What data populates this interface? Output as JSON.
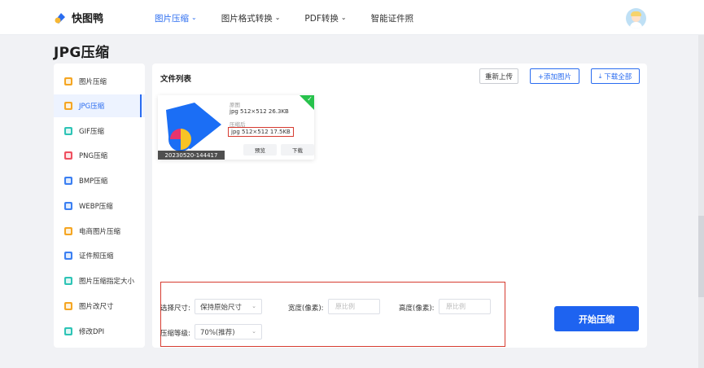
{
  "header": {
    "logo_text": "快图鸭",
    "nav": [
      {
        "label": "图片压缩",
        "chevron": true,
        "active": true
      },
      {
        "label": "图片格式转换",
        "chevron": true
      },
      {
        "label": "PDF转换",
        "chevron": true
      },
      {
        "label": "智能证件照",
        "chevron": false
      }
    ]
  },
  "page": {
    "title": "JPG压缩"
  },
  "sidebar": {
    "items": [
      {
        "label": "图片压缩",
        "color": "#f5a623"
      },
      {
        "label": "JPG压缩",
        "color": "#f5a623",
        "active": true
      },
      {
        "label": "GIF压缩",
        "color": "#2ec4b6"
      },
      {
        "label": "PNG压缩",
        "color": "#ef4f5f"
      },
      {
        "label": "BMP压缩",
        "color": "#3b7ff2"
      },
      {
        "label": "WEBP压缩",
        "color": "#3b7ff2"
      },
      {
        "label": "电商图片压缩",
        "color": "#f5a623"
      },
      {
        "label": "证件照压缩",
        "color": "#3b7ff2"
      },
      {
        "label": "图片压缩指定大小",
        "color": "#2ec4b6"
      },
      {
        "label": "图片改尺寸",
        "color": "#f5a623"
      },
      {
        "label": "修改DPI",
        "color": "#2ec4b6"
      }
    ]
  },
  "main": {
    "file_list_title": "文件列表",
    "buttons": {
      "reupload": "重新上传",
      "add": "+添加图片",
      "download_all": "下载全部"
    },
    "file": {
      "caption": "20230520-144417",
      "original_label": "原图",
      "original_info": "jpg  512×512  26.3KB",
      "compressed_label": "压缩后",
      "compressed_info": "jpg  512×512  17.5KB",
      "preview": "预览",
      "download": "下载"
    },
    "settings": {
      "size_label": "选择尺寸:",
      "size_value": "保持原始尺寸",
      "width_label": "宽度(像素):",
      "width_placeholder": "原比例",
      "height_label": "高度(像素):",
      "height_placeholder": "原比例",
      "level_label": "压缩等级:",
      "level_value": "70%(推荐)"
    },
    "start_button": "开始压缩"
  },
  "colors": {
    "accent": "#2a6cf0",
    "highlight_red": "#d63b30",
    "success": "#27c24c"
  }
}
